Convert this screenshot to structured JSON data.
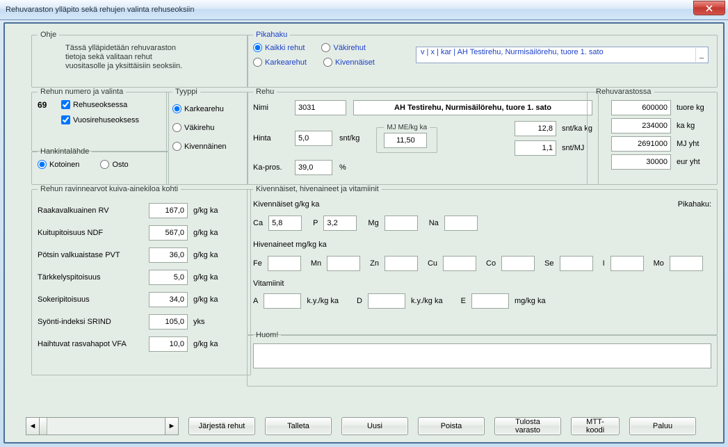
{
  "window_title": "Rehuvaraston ylläpito sekä rehujen valinta rehuseoksiin",
  "ohje": {
    "legend": "Ohje",
    "l1": "Tässä ylläpidetään rehuvaraston",
    "l2": "tietoja sekä valitaan rehut",
    "l3": "vuositasolle ja yksittäisiin seoksiin."
  },
  "pikahaku": {
    "legend": "Pikahaku",
    "opt_all": "Kaikki rehut",
    "opt_vaki": "Väkirehut",
    "opt_karkea": "Karkearehut",
    "opt_kiven": "Kivennäiset",
    "selected": "v | x | kar | AH Testirehu, Nurmisäilörehu, tuore 1. sato"
  },
  "num": {
    "legend": "Rehun numero ja valinta",
    "id": "69",
    "chk1": "Rehuseoksessa",
    "chk2": "Vuosirehuseoksess"
  },
  "hankinta": {
    "legend": "Hankintalähde",
    "opt1": "Kotoinen",
    "opt2": "Osto"
  },
  "tyyppi": {
    "legend": "Tyyppi",
    "opt1": "Karkearehu",
    "opt2": "Väkirehu",
    "opt3": "Kivennäinen"
  },
  "rehu": {
    "legend": "Rehu",
    "nimi_lbl": "Nimi",
    "nimi_val": "3031",
    "nimi_full": "AH Testirehu, Nurmisäilörehu, tuore 1. sato",
    "hinta_lbl": "Hinta",
    "hinta_val": "5,0",
    "hinta_unit": "snt/kg",
    "me_lbl": "MJ ME/kg ka",
    "me_val": "11,50",
    "ka_lbl": "Ka-pros.",
    "ka_val": "39,0",
    "ka_unit": "%",
    "sntka_val": "12,8",
    "sntka_lbl": "snt/ka kg",
    "sntmj_val": "1,1",
    "sntmj_lbl": "snt/MJ"
  },
  "varasto": {
    "legend": "Rehuvarastossa",
    "v1": "600000",
    "u1": "tuore kg",
    "v2": "234000",
    "u2": "ka kg",
    "v3": "2691000",
    "u3": "MJ yht",
    "v4": "30000",
    "u4": "eur  yht"
  },
  "nutri": {
    "legend": "Rehun ravinnearvot kuiva-ainekiloa kohti",
    "unit": "g/kg ka",
    "unit_yks": "yks",
    "rv_lbl": "Raakavalkuainen RV",
    "rv_val": "167,0",
    "ndf_lbl": "Kuitupitoisuus NDF",
    "ndf_val": "567,0",
    "pvt_lbl": "Pötsin valkuaistase PVT",
    "pvt_val": "36,0",
    "tark_lbl": "Tärkkelyspitoisuus",
    "tark_val": "5,0",
    "sok_lbl": "Sokeripitoisuus",
    "sok_val": "34,0",
    "srind_lbl": "Syönti-indeksi SRIND",
    "srind_val": "105,0",
    "vfa_lbl": "Haihtuvat rasvahapot  VFA",
    "vfa_val": "10,0"
  },
  "mineral": {
    "legend": "Kivennäiset, hivenaineet ja vitamiinit",
    "kiv_lbl": "Kivennäiset  g/kg ka",
    "pikahaku": "Pikahaku:",
    "ca": "Ca",
    "ca_v": "5,8",
    "p": "P",
    "p_v": "3,2",
    "mg": "Mg",
    "mg_v": "",
    "na": "Na",
    "na_v": "",
    "hiv_lbl": "Hivenaineet mg/kg ka",
    "fe": "Fe",
    "mn": "Mn",
    "zn": "Zn",
    "cu": "Cu",
    "co": "Co",
    "se": "Se",
    "i": "I",
    "mo": "Mo",
    "vit_lbl": "Vitamiinit",
    "a": "A",
    "a_u": "k.y./kg ka",
    "d": "D",
    "d_u": "k.y./kg ka",
    "e": "E",
    "e_u": "mg/kg ka"
  },
  "huom": {
    "legend": "Huom!",
    "val": ""
  },
  "buttons": {
    "b1": "Järjestä rehut",
    "b2": "Talleta",
    "b3": "Uusi",
    "b4": "Poista",
    "b5": "Tulosta varasto",
    "b6": "MTT-koodi",
    "b7": "Paluu"
  }
}
